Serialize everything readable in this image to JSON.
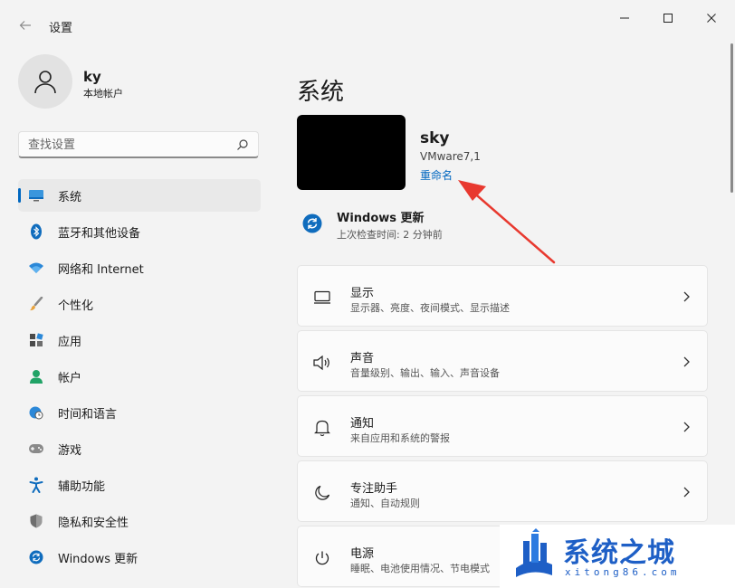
{
  "window": {
    "title": "设置"
  },
  "profile": {
    "name": "ky",
    "type": "本地帐户"
  },
  "search": {
    "placeholder": "查找设置"
  },
  "nav": {
    "items": [
      {
        "label": "系统",
        "icon": "display-system-icon"
      },
      {
        "label": "蓝牙和其他设备",
        "icon": "bluetooth-icon"
      },
      {
        "label": "网络和 Internet",
        "icon": "wifi-icon"
      },
      {
        "label": "个性化",
        "icon": "brush-icon"
      },
      {
        "label": "应用",
        "icon": "apps-icon"
      },
      {
        "label": "帐户",
        "icon": "account-icon"
      },
      {
        "label": "时间和语言",
        "icon": "globe-clock-icon"
      },
      {
        "label": "游戏",
        "icon": "gamepad-icon"
      },
      {
        "label": "辅助功能",
        "icon": "accessibility-icon"
      },
      {
        "label": "隐私和安全性",
        "icon": "shield-icon"
      },
      {
        "label": "Windows 更新",
        "icon": "update-icon"
      }
    ]
  },
  "main": {
    "title": "系统",
    "device": {
      "name": "sky",
      "model": "VMware7,1",
      "rename": "重命名"
    },
    "update": {
      "title": "Windows 更新",
      "subtitle": "上次检查时间: 2 分钟前"
    },
    "cards": [
      {
        "title": "显示",
        "subtitle": "显示器、亮度、夜间模式、显示描述",
        "icon": "monitor-icon"
      },
      {
        "title": "声音",
        "subtitle": "音量级别、输出、输入、声音设备",
        "icon": "speaker-icon"
      },
      {
        "title": "通知",
        "subtitle": "来自应用和系统的警报",
        "icon": "bell-icon"
      },
      {
        "title": "专注助手",
        "subtitle": "通知、自动规则",
        "icon": "moon-icon"
      },
      {
        "title": "电源",
        "subtitle": "睡眠、电池使用情况、节电模式",
        "icon": "power-icon"
      }
    ]
  },
  "watermark": {
    "text": "系统之城",
    "url": "xitong86.com"
  },
  "colors": {
    "accent": "#0067c0",
    "arrow": "#e8392f",
    "watermark": "#1e5fc6"
  }
}
